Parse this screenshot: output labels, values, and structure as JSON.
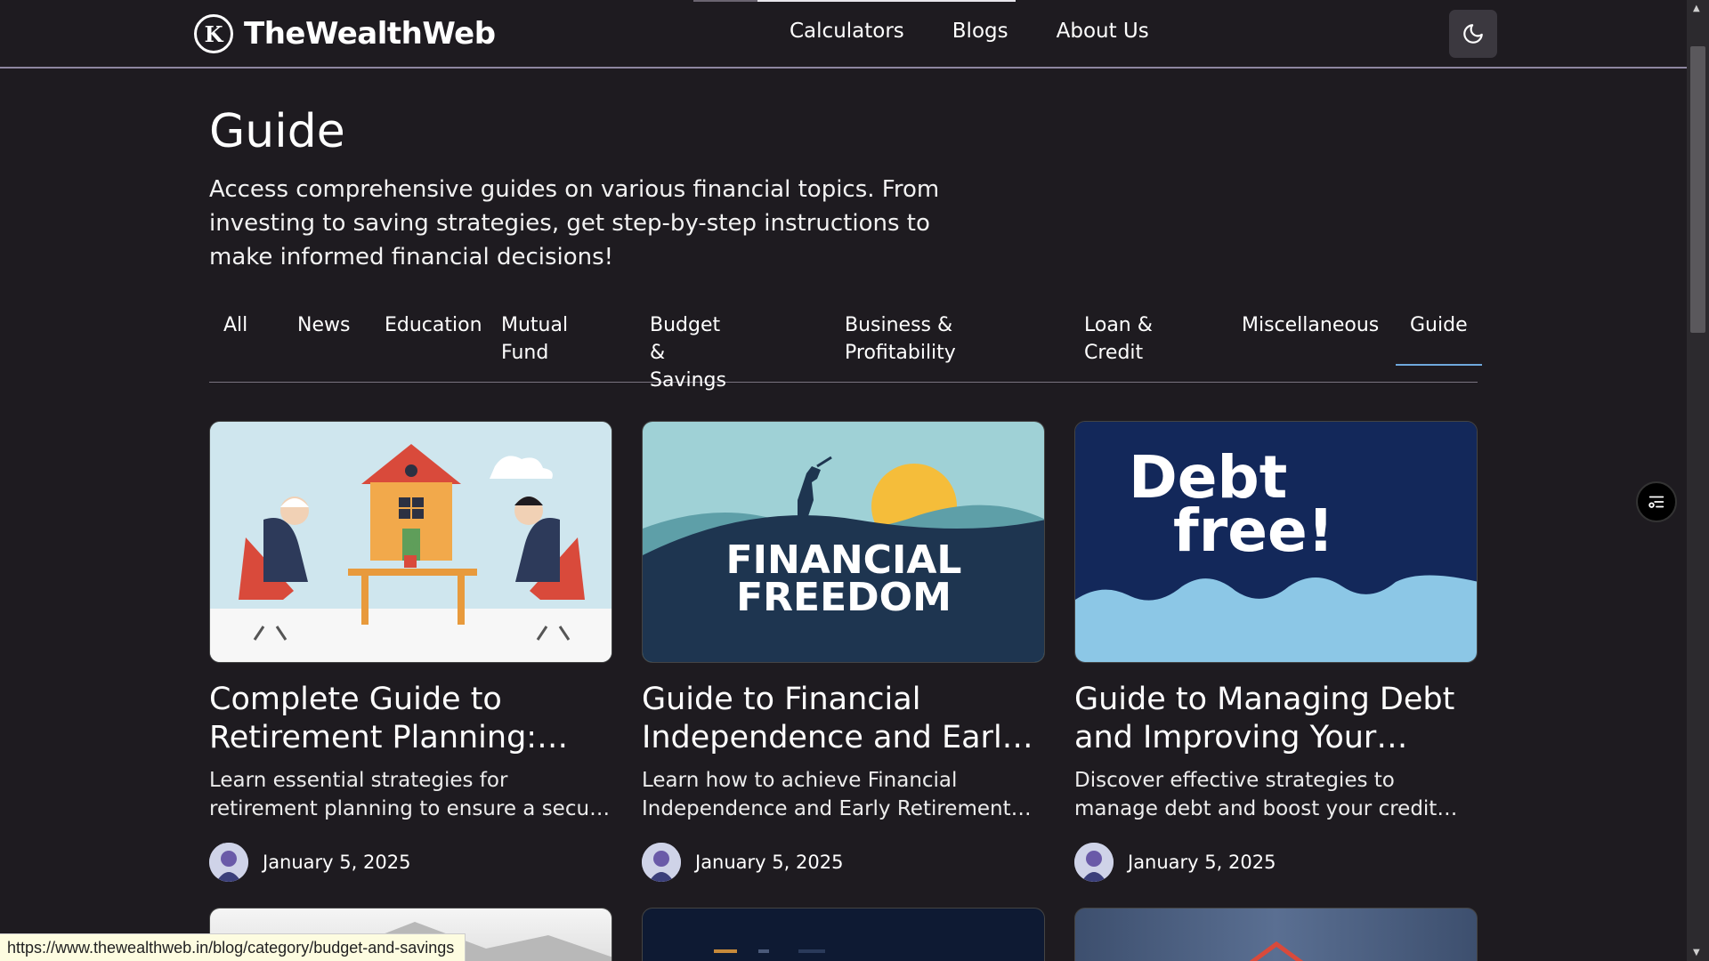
{
  "header": {
    "brand": "TheWealthWeb",
    "nav": [
      "Calculators",
      "Blogs",
      "About Us"
    ],
    "theme_toggle_icon": "moon-icon"
  },
  "main": {
    "title": "Guide",
    "description": "Access comprehensive guides on various financial topics. From investing to saving strategies, get step-by-step instructions to make informed financial decisions!",
    "tabs": [
      {
        "label": "All"
      },
      {
        "label": "News"
      },
      {
        "label": "Education"
      },
      {
        "label": "Mutual Fund"
      },
      {
        "label": "Budget & Savings"
      },
      {
        "label": "Business & Profitability"
      },
      {
        "label": "Loan & Credit"
      },
      {
        "label": "Miscellaneous"
      },
      {
        "label": "Guide",
        "active": true
      }
    ],
    "cards": [
      {
        "title": "Complete Guide to Retirement Planning: Secure Your Future",
        "excerpt": "Learn essential strategies for retirement planning to ensure a secure and comfortable future.",
        "date": "January 5, 2025",
        "image_icon": "retirement-planning-illustration"
      },
      {
        "title": "Guide to Financial Independence and Early Retirement (FIRE)",
        "excerpt": "Learn how to achieve Financial Independence and Early Retirement (FIRE) with proven strategies.",
        "date": "January 5, 2025",
        "image_icon": "financial-freedom-illustration",
        "image_text": [
          "FINANCIAL",
          "FREEDOM"
        ]
      },
      {
        "title": "Guide to Managing Debt and Improving Your Credit Score",
        "excerpt": "Discover effective strategies to manage debt and boost your credit score. Learn practical steps.",
        "date": "January 5, 2025",
        "image_icon": "debt-free-illustration",
        "image_text": [
          "Debt",
          "free!"
        ]
      }
    ]
  },
  "status_url": "https://www.thewealthweb.in/blog/category/budget-and-savings",
  "colors": {
    "background": "#1e1b20",
    "active_tab": "#6fa8dc",
    "status_bg": "#fdfce0"
  }
}
